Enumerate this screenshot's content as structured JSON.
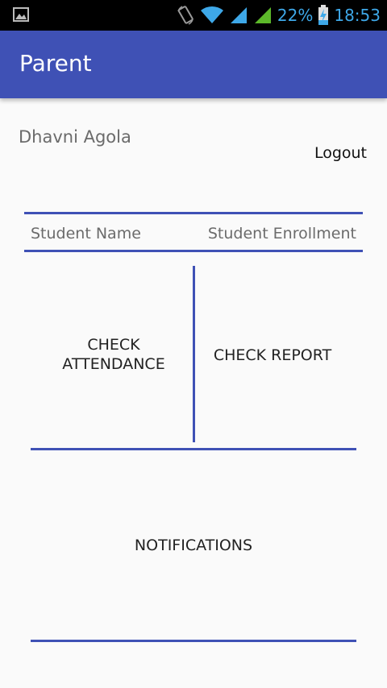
{
  "status_bar": {
    "battery": "22%",
    "time": "18:53",
    "icons": [
      "gallery-icon",
      "rotate-icon",
      "wifi-icon",
      "signal-icon",
      "signal-icon",
      "battery-charging-icon"
    ]
  },
  "app_bar": {
    "title": "Parent"
  },
  "user": {
    "name": "Dhavni Agola"
  },
  "logout_label": "Logout",
  "student_table": {
    "name_header": "Student Name",
    "enrollment_header": "Student Enrollment"
  },
  "actions": {
    "check_attendance": "CHECK\nATTENDANCE",
    "check_report": "CHECK REPORT",
    "notifications": "NOTIFICATIONS"
  },
  "colors": {
    "primary": "#3f51b5",
    "status_accent": "#3ea8e8"
  }
}
